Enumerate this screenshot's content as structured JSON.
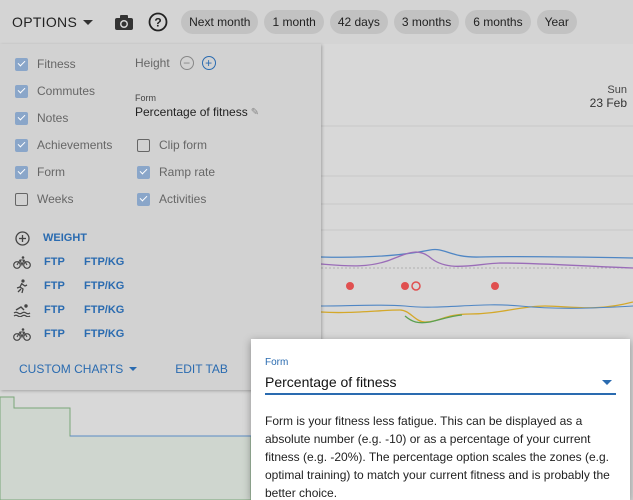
{
  "toolbar": {
    "options_label": "OPTIONS",
    "camera_icon": "camera-icon",
    "help_icon": "help-icon",
    "ranges": [
      "Next month",
      "1 month",
      "42 days",
      "3 months",
      "6 months",
      "Year"
    ]
  },
  "chart": {
    "day_name": "Sun",
    "day_date": "23 Feb",
    "line_colors": {
      "fitness": "#4f86c4",
      "fatigue": "#9a6cb8",
      "form_positive": "#d4a82a",
      "form_green": "#5aa050",
      "dots": "#e05050"
    }
  },
  "panel": {
    "checkboxes_left": [
      {
        "label": "Fitness",
        "checked": true
      },
      {
        "label": "Commutes",
        "checked": true
      },
      {
        "label": "Notes",
        "checked": true
      },
      {
        "label": "Achievements",
        "checked": true
      },
      {
        "label": "Form",
        "checked": true
      },
      {
        "label": "Weeks",
        "checked": false
      }
    ],
    "height_label": "Height",
    "form_label": "Form",
    "form_value": "Percentage of fitness",
    "checkboxes_right": [
      {
        "label": "Clip form",
        "checked": false
      },
      {
        "label": "Ramp rate",
        "checked": true
      },
      {
        "label": "Activities",
        "checked": true
      }
    ],
    "weight_label": "WEIGHT",
    "metrics": [
      {
        "icon": "bike-icon",
        "a": "FTP",
        "b": "FTP/KG"
      },
      {
        "icon": "run-icon",
        "a": "FTP",
        "b": "FTP/KG"
      },
      {
        "icon": "swim-icon",
        "a": "FTP",
        "b": "FTP/KG"
      },
      {
        "icon": "bike-icon",
        "a": "FTP",
        "b": "FTP/KG"
      }
    ],
    "custom_charts_label": "CUSTOM CHARTS",
    "edit_tab_label": "EDIT TAB"
  },
  "dialog": {
    "field_label": "Form",
    "selected_value": "Percentage of fitness",
    "help_text": "Form is your fitness less fatigue. This can be displayed as a absolute number (e.g. -10) or as a percentage of your current fitness (e.g. -20%). The percentage option scales the zones (e.g. optimal training) to match your current fitness and is probably the better choice."
  }
}
